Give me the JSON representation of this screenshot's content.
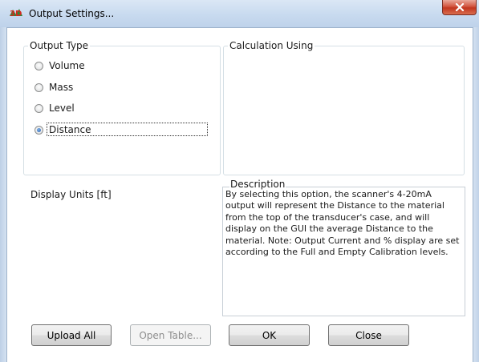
{
  "window": {
    "title": "Output Settings...",
    "app_icon": "3d-scanner-app-icon",
    "close_icon": "close-x-icon"
  },
  "output_type": {
    "legend": "Output Type",
    "options": [
      {
        "label": "Volume",
        "checked": false
      },
      {
        "label": "Mass",
        "checked": false
      },
      {
        "label": "Level",
        "checked": false
      },
      {
        "label": "Distance",
        "checked": true
      }
    ]
  },
  "calculation": {
    "legend": "Calculation Using"
  },
  "display_units": {
    "label": "Display Units [ft]"
  },
  "description": {
    "legend": "Description",
    "text": "By selecting this option, the scanner's 4-20mA output will represent the Distance to the material from the top of the transducer's case, and will display on the GUI the average Distance to the material. Note: Output Current and % display are set according to the Full and Empty Calibration levels."
  },
  "buttons": {
    "upload_all": "Upload All",
    "open_table": "Open Table...",
    "ok": "OK",
    "close": "Close"
  },
  "colors": {
    "titlebar": "#c8daef",
    "close_button": "#c2361f",
    "radio_checked": "#2a5fb0",
    "groupbox_border": "#d5dfe5"
  }
}
